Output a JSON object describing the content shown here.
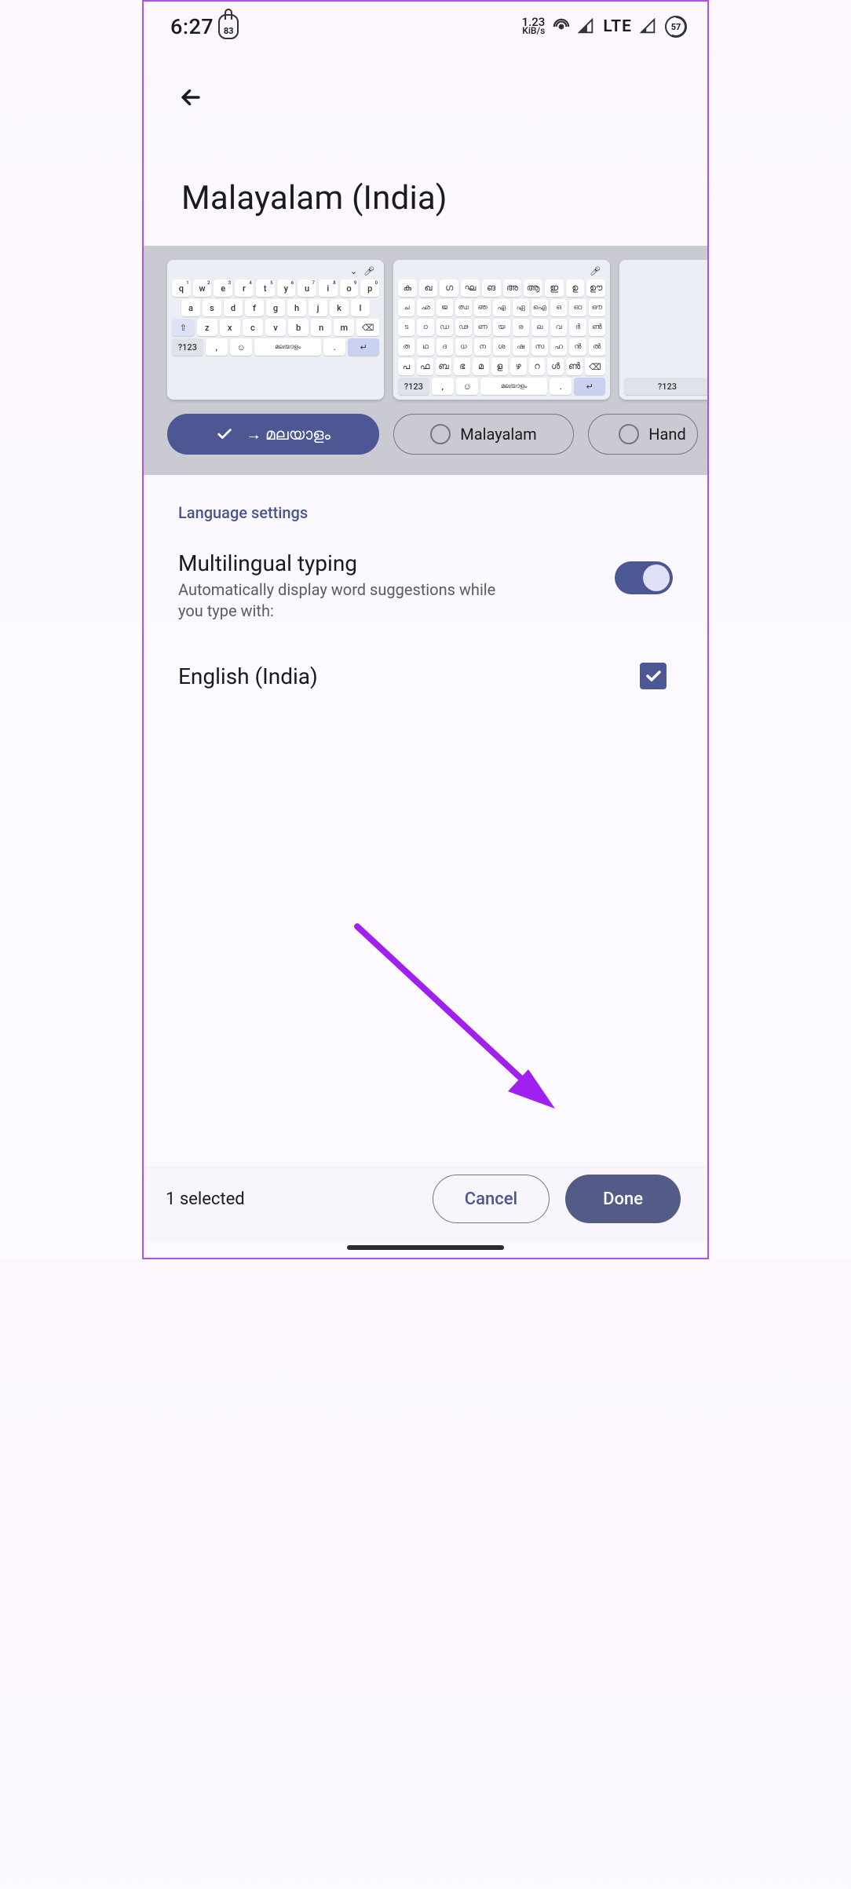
{
  "statusbar": {
    "time": "6:27",
    "lock_battery_small": "83",
    "kibs_top": "1.23",
    "kibs_bottom": "KiB/s",
    "lte": "LTE",
    "battery_pct": "57"
  },
  "page": {
    "title": "Malayalam (India)"
  },
  "keyboard_previews": {
    "row1": [
      "q",
      "w",
      "e",
      "r",
      "t",
      "y",
      "u",
      "i",
      "o",
      "p"
    ],
    "row1_sup": [
      "1",
      "2",
      "3",
      "4",
      "5",
      "6",
      "7",
      "8",
      "9",
      "0"
    ],
    "row2": [
      "a",
      "s",
      "d",
      "f",
      "g",
      "h",
      "j",
      "k",
      "l"
    ],
    "row3": [
      "z",
      "x",
      "c",
      "v",
      "b",
      "n",
      "m"
    ],
    "space_label_1": "മലയാളം",
    "sym_label": "?123",
    "native_row1": [
      "ക",
      "ഖ",
      "ഗ",
      "ഘ",
      "ങ",
      "അ",
      "ആ",
      "ഇ",
      "ഉ",
      "ഊ"
    ],
    "native_row2": [
      "ച",
      "ഛ",
      "ജ",
      "ഝ",
      "ഞ",
      "എ",
      "ഏ",
      "ഐ",
      "ഒ",
      "ഓ",
      "ഔ"
    ],
    "native_row3": [
      "ട",
      "ഠ",
      "ഡ",
      "ഢ",
      "ണ",
      "യ",
      "ര",
      "ല",
      "വ",
      "ർ",
      "ൺ"
    ],
    "native_row4": [
      "ത",
      "ഥ",
      "ദ",
      "ധ",
      "ന",
      "ശ",
      "ഷ",
      "സ",
      "ഹ",
      "ൻ",
      "ൽ"
    ],
    "native_row5": [
      "പ",
      "ഫ",
      "ബ",
      "ഭ",
      "മ",
      "ള",
      "ഴ",
      "റ",
      "ൾ",
      "ൺ"
    ],
    "space_label_2": "മലയാളം"
  },
  "chips": [
    {
      "label": "→ മലയാളം",
      "selected": true
    },
    {
      "label": "Malayalam",
      "selected": false
    },
    {
      "label": "Handwriting",
      "selected": false
    }
  ],
  "settings": {
    "section_label": "Language settings",
    "multilingual": {
      "title": "Multilingual typing",
      "subtitle": "Automatically display word suggestions while you type with:",
      "enabled": true
    },
    "languages": [
      {
        "name": "English (India)",
        "checked": true
      }
    ]
  },
  "footer": {
    "selected_count": "1 selected",
    "cancel": "Cancel",
    "done": "Done"
  }
}
